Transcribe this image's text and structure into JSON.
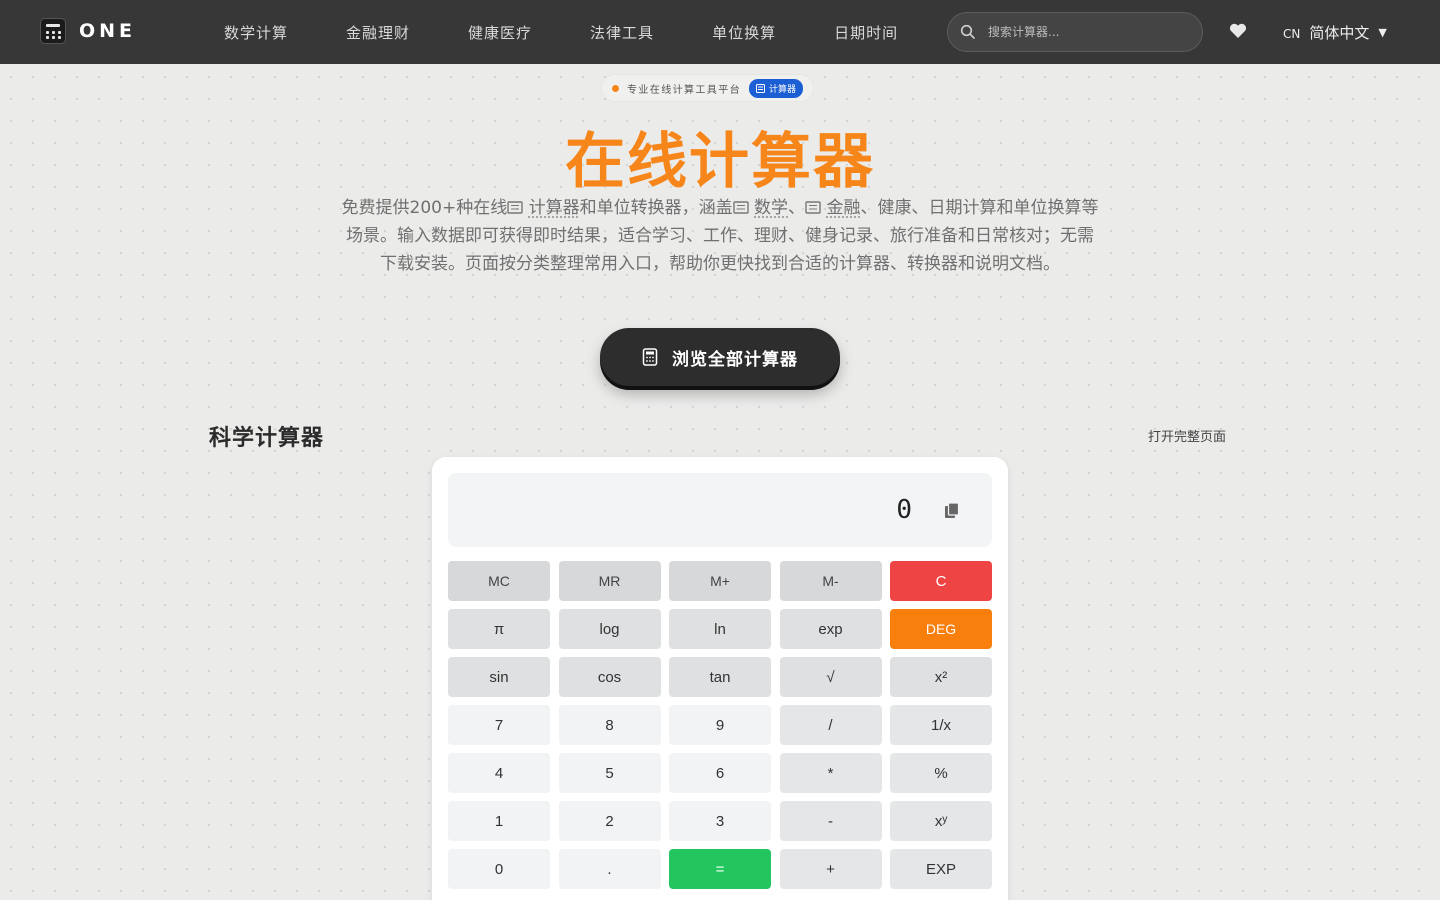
{
  "header": {
    "logo_text": "ONE",
    "nav": [
      {
        "label": "数学计算"
      },
      {
        "label": "金融理财"
      },
      {
        "label": "健康医疗"
      },
      {
        "label": "法律工具"
      },
      {
        "label": "单位换算"
      },
      {
        "label": "日期时间"
      }
    ],
    "search_placeholder": "搜索计算器...",
    "lang_code": "CN",
    "lang_name": "简体中文"
  },
  "hero": {
    "badge_text": "专业在线计算工具平台",
    "badge_tag": "计算器",
    "title": "在线计算器",
    "desc": {
      "p1": "免费提供200+种在线",
      "link1": "计算器",
      "p2": "和单位转换器，涵盖",
      "link2": "数学",
      "p3": "、",
      "link3": "金融",
      "p4": "、健康、日期计算和单位换算等场景。输入数据即可获得即时结果，适合学习、工作、理财、健身记录、旅行准备和日常核对；无需下载安装。页面按分类整理常用入口，帮助你更快找到合适的计算器、转换器和说明文档。"
    },
    "cta_label": "浏览全部计算器"
  },
  "section": {
    "title": "科学计算器",
    "open_full_label": "打开完整页面"
  },
  "calculator": {
    "display_value": "0",
    "keys": [
      {
        "label": "MC",
        "kind": "mem",
        "name": "key-mc"
      },
      {
        "label": "MR",
        "kind": "mem",
        "name": "key-mr"
      },
      {
        "label": "M+",
        "kind": "mem",
        "name": "key-m-plus"
      },
      {
        "label": "M-",
        "kind": "mem",
        "name": "key-m-minus"
      },
      {
        "label": "C",
        "kind": "clear",
        "name": "key-clear"
      },
      {
        "label": "π",
        "kind": "fn",
        "name": "key-pi"
      },
      {
        "label": "log",
        "kind": "fn",
        "name": "key-log"
      },
      {
        "label": "ln",
        "kind": "fn",
        "name": "key-ln"
      },
      {
        "label": "exp",
        "kind": "fn",
        "name": "key-exp-fn"
      },
      {
        "label": "DEG",
        "kind": "deg",
        "name": "key-deg"
      },
      {
        "label": "sin",
        "kind": "fn",
        "name": "key-sin"
      },
      {
        "label": "cos",
        "kind": "fn",
        "name": "key-cos"
      },
      {
        "label": "tan",
        "kind": "fn",
        "name": "key-tan"
      },
      {
        "label": "√",
        "kind": "fn",
        "name": "key-sqrt"
      },
      {
        "label": "x²",
        "kind": "fn",
        "name": "key-square"
      },
      {
        "label": "7",
        "kind": "num",
        "name": "key-7"
      },
      {
        "label": "8",
        "kind": "num",
        "name": "key-8"
      },
      {
        "label": "9",
        "kind": "num",
        "name": "key-9"
      },
      {
        "label": "/",
        "kind": "op",
        "name": "key-divide"
      },
      {
        "label": "1/x",
        "kind": "op",
        "name": "key-reciprocal"
      },
      {
        "label": "4",
        "kind": "num",
        "name": "key-4"
      },
      {
        "label": "5",
        "kind": "num",
        "name": "key-5"
      },
      {
        "label": "6",
        "kind": "num",
        "name": "key-6"
      },
      {
        "label": "*",
        "kind": "op",
        "name": "key-multiply"
      },
      {
        "label": "%",
        "kind": "op",
        "name": "key-percent"
      },
      {
        "label": "1",
        "kind": "num",
        "name": "key-1"
      },
      {
        "label": "2",
        "kind": "num",
        "name": "key-2"
      },
      {
        "label": "3",
        "kind": "num",
        "name": "key-3"
      },
      {
        "label": "-",
        "kind": "op",
        "name": "key-subtract"
      },
      {
        "label": "xʸ",
        "kind": "op",
        "name": "key-power"
      },
      {
        "label": "0",
        "kind": "num",
        "name": "key-0"
      },
      {
        "label": ".",
        "kind": "num",
        "name": "key-decimal"
      },
      {
        "label": "=",
        "kind": "eq",
        "name": "key-equals"
      },
      {
        "label": "+",
        "kind": "op",
        "name": "key-add"
      },
      {
        "label": "EXP",
        "kind": "op",
        "name": "key-exp"
      }
    ]
  }
}
